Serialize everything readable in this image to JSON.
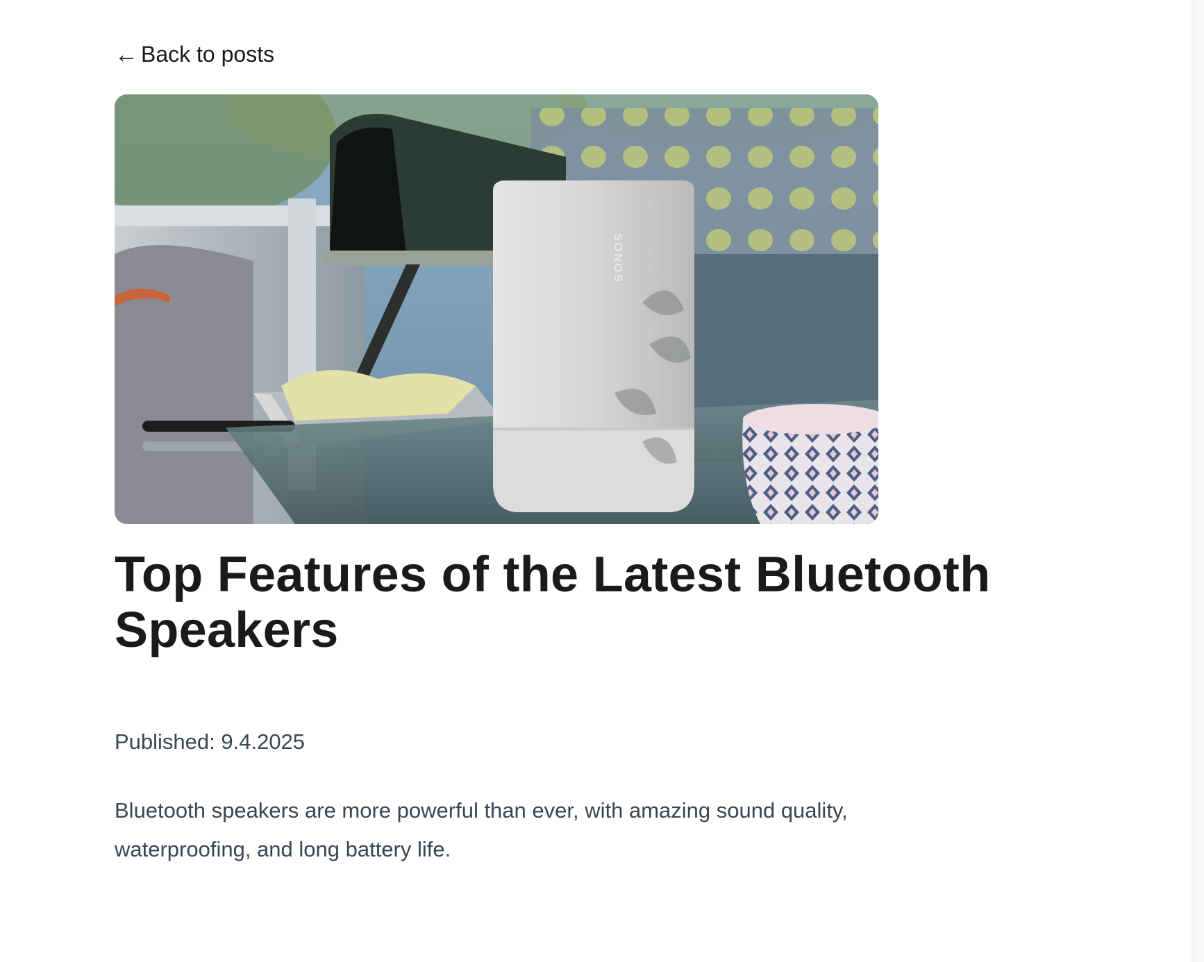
{
  "nav": {
    "back_arrow": "←",
    "back_label": "Back to posts"
  },
  "hero_image": {
    "description_icon": "speaker-photo",
    "speaker_brand_text": "SONOS"
  },
  "post": {
    "title": "Top Features of the Latest Bluetooth Speakers",
    "published": "Published: 9.4.2025",
    "excerpt": "Bluetooth speakers are more powerful than ever, with amazing sound quality, waterproofing, and long battery life."
  }
}
